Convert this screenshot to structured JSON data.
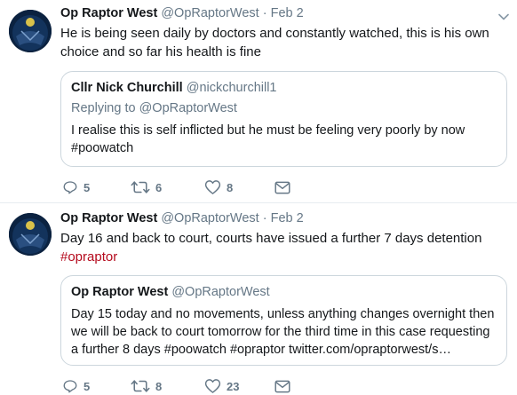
{
  "tweets": [
    {
      "name": "Op Raptor West",
      "handle": "@OpRaptorWest",
      "dot": "·",
      "date": "Feb 2",
      "text": "He is being seen daily by doctors and constantly watched, this is his own choice and so far his health is fine",
      "quote": {
        "name": "Cllr Nick Churchill",
        "handle": "@nickchurchill1",
        "replying_prefix": "Replying to",
        "replying_handle": "@OpRaptorWest",
        "text": "I realise this is self inflicted but he must be feeling very poorly by now",
        "hashtag": "#poowatch"
      },
      "actions": {
        "replies": "5",
        "retweets": "6",
        "likes": "8"
      }
    },
    {
      "name": "Op Raptor West",
      "handle": "@OpRaptorWest",
      "dot": "·",
      "date": "Feb 2",
      "text": "Day 16 and back to court, courts have issued a further 7 days detention",
      "hashtag": "#opraptor",
      "quote": {
        "name": "Op Raptor West",
        "handle": "@OpRaptorWest",
        "text": "Day 15 today and no movements, unless anything changes overnight then we will be back to court tomorrow for the third time in this case requesting a further 8 days #poowatch #opraptor twitter.com/opraptorwest/s…"
      },
      "actions": {
        "replies": "5",
        "retweets": "8",
        "likes": "23"
      }
    }
  ],
  "icons": {
    "reply": "reply-icon",
    "retweet": "retweet-icon",
    "like": "heart-icon",
    "dm": "envelope-icon",
    "caret": "chevron-down-icon"
  },
  "colors": {
    "hashtag": "#b50a1d",
    "muted": "#657786",
    "border": "#ccd6dd"
  }
}
